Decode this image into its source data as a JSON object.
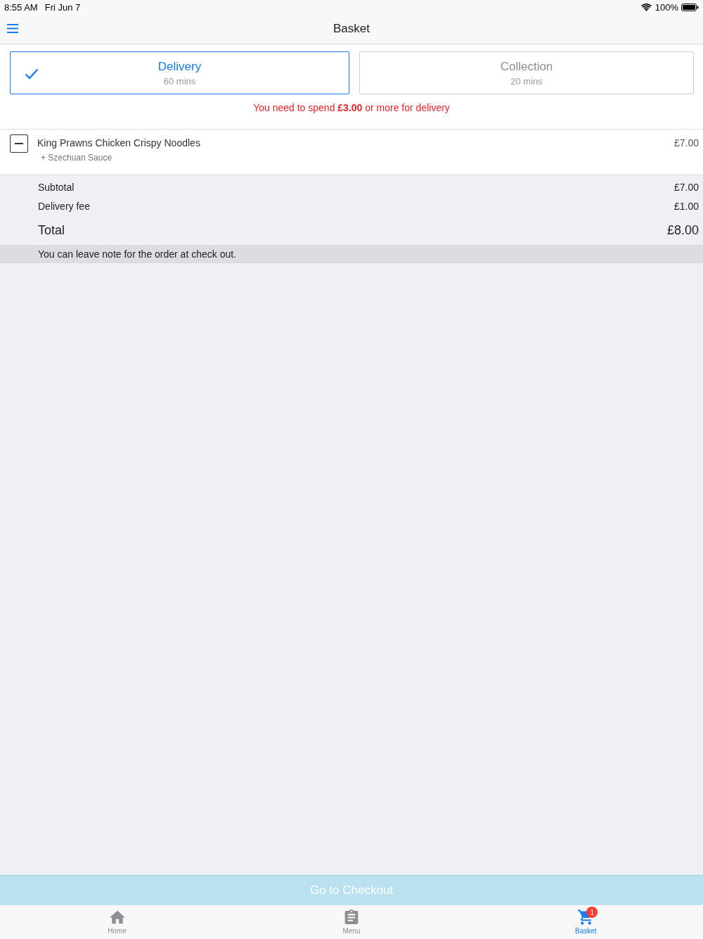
{
  "status_bar": {
    "time": "8:55 AM",
    "date": "Fri Jun 7",
    "battery": "100%"
  },
  "nav_bar": {
    "title": "Basket"
  },
  "order_types": [
    {
      "label": "Delivery",
      "time": "60 mins",
      "selected": true
    },
    {
      "label": "Collection",
      "time": "20 mins",
      "selected": false
    }
  ],
  "notice": "You need to spend **£3.00** or more for delivery",
  "items": [
    {
      "name": "King Prawns Chicken Crispy Noodles",
      "options": [
        "+ Szechuan Sauce"
      ],
      "price": "£7.00"
    }
  ],
  "summary": [
    {
      "kind": "line",
      "label": "Subtotal",
      "value": "£7.00"
    },
    {
      "kind": "line",
      "label": "Delivery fee",
      "value": "£1.00"
    },
    {
      "kind": "total",
      "label": "Total",
      "value": "£8.00"
    }
  ],
  "note": "You can leave note for the order at check out.",
  "checkout_button": {
    "label": "Go to Checkout",
    "disabled": true
  },
  "tab_bar": [
    {
      "kind": "home",
      "label": "Home",
      "selected": false
    },
    {
      "kind": "menu",
      "label": "Menu",
      "selected": false
    },
    {
      "kind": "cart",
      "label": "Basket",
      "selected": true,
      "badge": "1"
    }
  ]
}
